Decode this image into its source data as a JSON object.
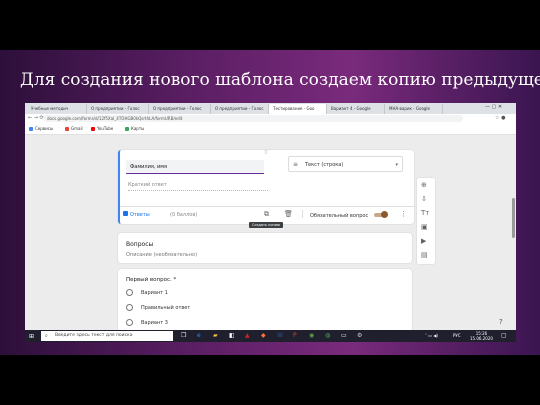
{
  "slide_title": "Для создания нового шаблона создаем копию предыдущего",
  "browser": {
    "tabs": [
      "Учебные методич",
      "О предприятии - Голос",
      "О предприятии - Голос",
      "О предприятии - Голос",
      "Тестирование - Goo",
      "Вариант 4 - Google",
      "MHA-варик - Google"
    ],
    "url": "docs.google.com/forms/d/12f5XaI_4TOHGB0kQsrthLA/formURB/edit",
    "bookmarks": [
      "Сервисы",
      "Gmail",
      "YouTube",
      "Карты"
    ]
  },
  "question_card": {
    "title_value": "Фамилия, имя",
    "type_label": "Текст (строка)",
    "answer_placeholder": "Краткий ответ",
    "answers_label": "Ответы",
    "points_label": "(0 баллов)",
    "required_label": "Обязательный вопрос",
    "tooltip": "Создать копию"
  },
  "section": {
    "title": "Вопросы",
    "description": "Описание (необязательно)"
  },
  "question_2": {
    "title": "Первый вопрос. *",
    "options": [
      "Вариант 1",
      "Правильный ответ",
      "Вариант 3"
    ]
  },
  "taskbar": {
    "search_placeholder": "Введите здесь текст для поиска",
    "lang": "РУС",
    "time": "15:26",
    "date": "15.06.2020"
  },
  "colors": {
    "accent": "#4285f4",
    "form_theme": "#6a2aa0",
    "toggle_on": "#8b5a2b"
  }
}
